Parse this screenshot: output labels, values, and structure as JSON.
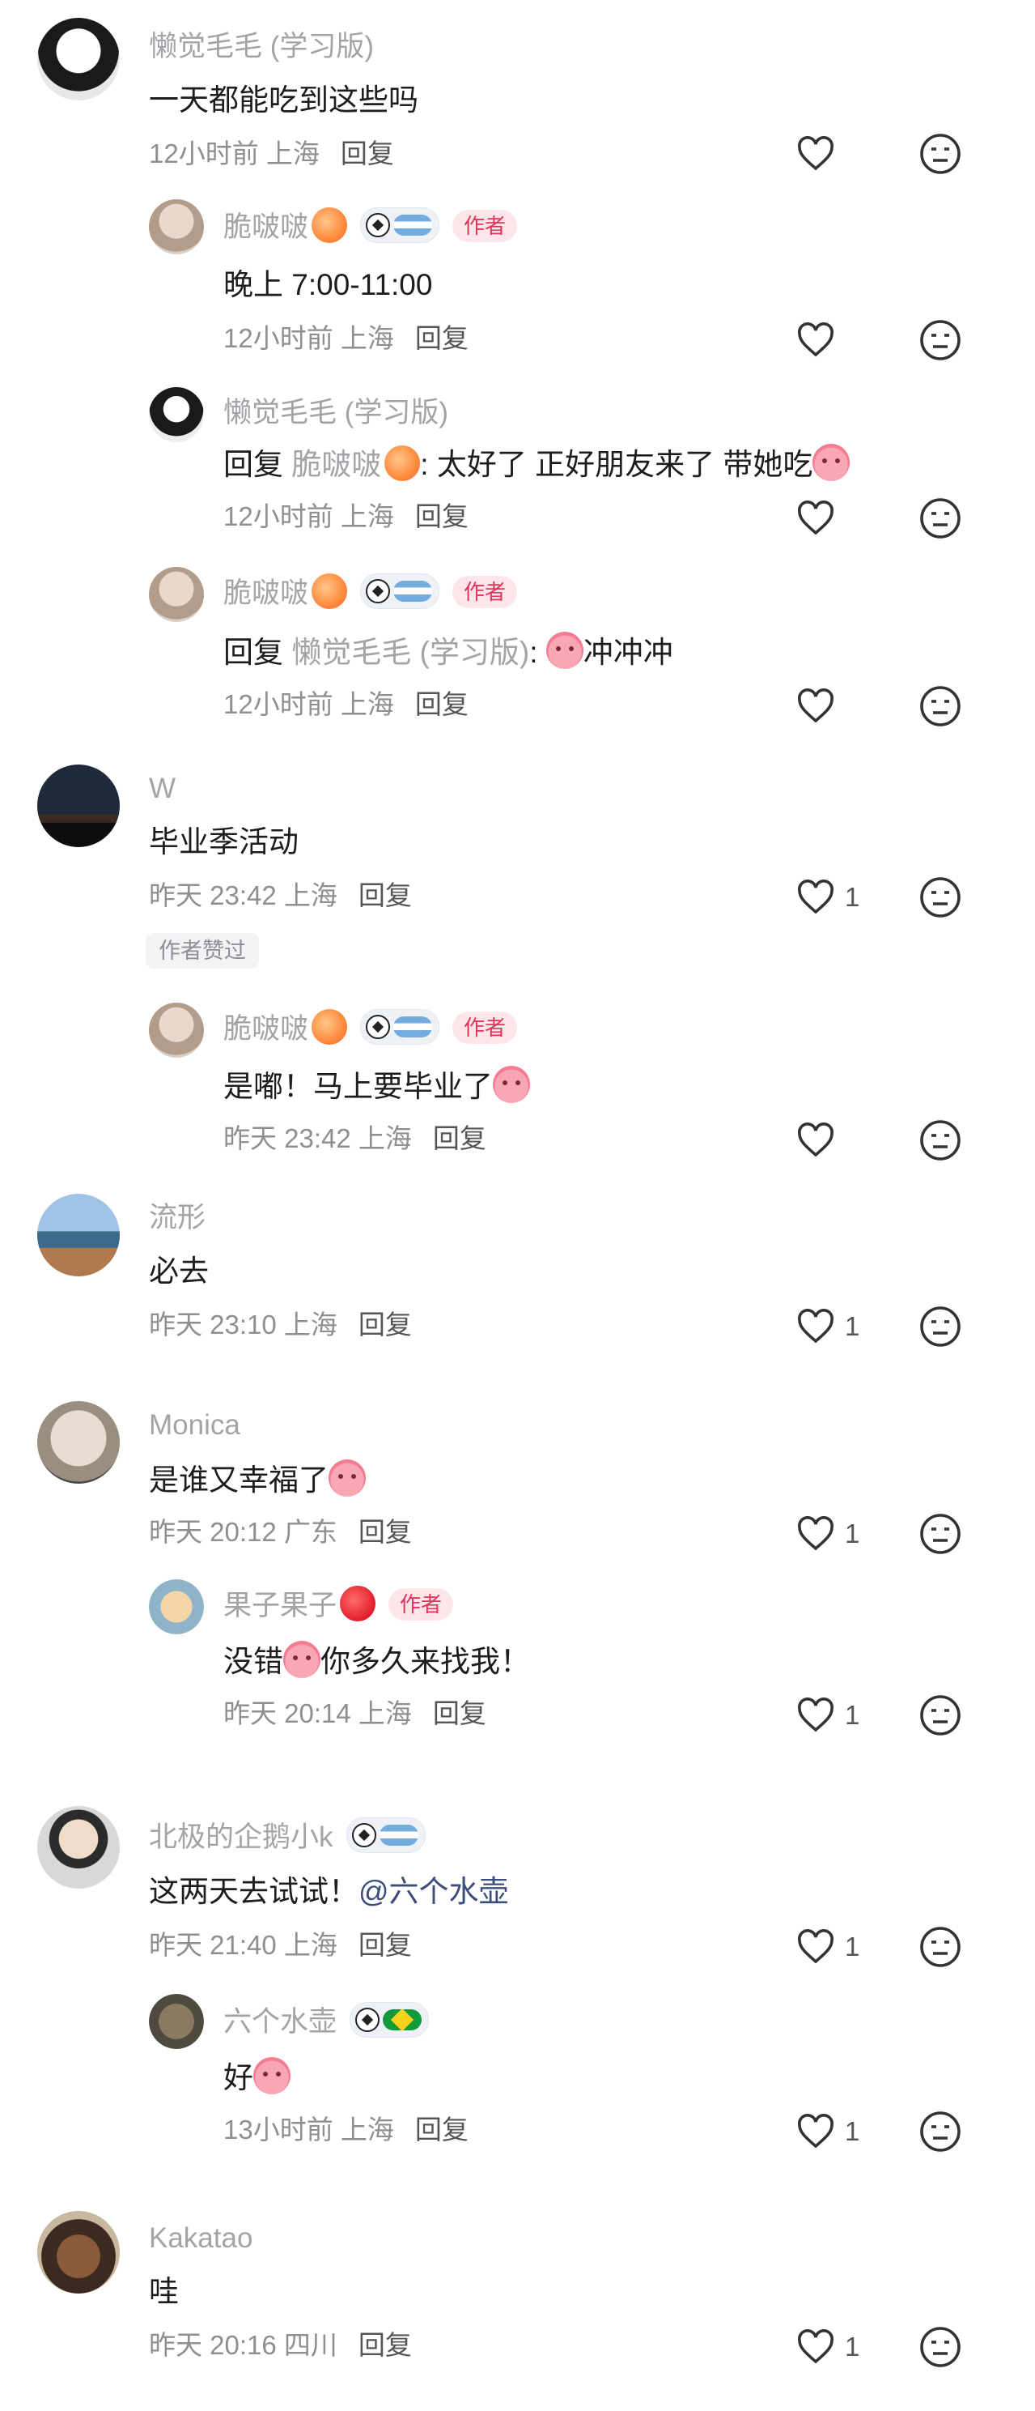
{
  "comments": [
    {
      "name": "懒觉毛毛 (学习版)",
      "text": "一天都能吃到这些吗",
      "meta": "12小时前 上海",
      "reply": "回复",
      "likes": ""
    },
    {
      "name": "脆啵啵",
      "author": "作者",
      "text": "晚上 7:00-11:00",
      "meta": "12小时前 上海",
      "reply": "回复",
      "likes": ""
    },
    {
      "name": "懒觉毛毛 (学习版)",
      "prefix": "回复",
      "target": "脆啵啵",
      "text": ": 太好了 正好朋友来了 带她吃",
      "meta": "12小时前 上海",
      "reply": "回复",
      "likes": ""
    },
    {
      "name": "脆啵啵",
      "author": "作者",
      "prefix": "回复",
      "target": "懒觉毛毛 (学习版)",
      "text": "冲冲冲",
      "meta": "12小时前 上海",
      "reply": "回复",
      "likes": ""
    },
    {
      "name": "W",
      "text": "毕业季活动",
      "meta": "昨天 23:42 上海",
      "reply": "回复",
      "likes": "1",
      "badge": "作者赞过"
    },
    {
      "name": "脆啵啵",
      "author": "作者",
      "text": "是嘟！马上要毕业了",
      "meta": "昨天 23:42 上海",
      "reply": "回复",
      "likes": ""
    },
    {
      "name": "流形",
      "text": "必去",
      "meta": "昨天 23:10 上海",
      "reply": "回复",
      "likes": "1"
    },
    {
      "name": "Monica",
      "text": "是谁又幸福了",
      "meta": "昨天 20:12 广东",
      "reply": "回复",
      "likes": "1"
    },
    {
      "name": "果子果子",
      "author": "作者",
      "text1": "没错",
      "text2": "你多久来找我！",
      "meta": "昨天 20:14 上海",
      "reply": "回复",
      "likes": "1"
    },
    {
      "name": "北极的企鹅小k",
      "text": "这两天去试试！",
      "mention": "@六个水壶",
      "meta": "昨天 21:40 上海",
      "reply": "回复",
      "likes": "1"
    },
    {
      "name": "六个水壶",
      "text": "好",
      "meta": "13小时前 上海",
      "reply": "回复",
      "likes": "1"
    },
    {
      "name": "Kakatao",
      "text": "哇",
      "meta": "昨天 20:16 四川",
      "reply": "回复",
      "likes": "1"
    }
  ],
  "colors": {
    "author_badge": "#e5325b",
    "name": "#a3a3a8",
    "mention": "#3b4e7b"
  }
}
